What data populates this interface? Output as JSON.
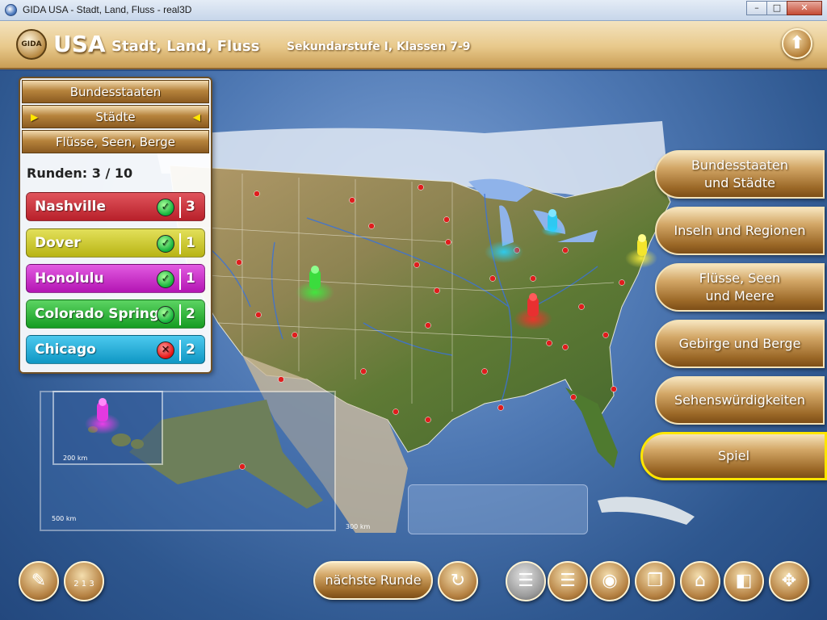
{
  "window": {
    "title": "GIDA USA - Stadt, Land, Fluss - real3D",
    "minimize": "–",
    "maximize": "□",
    "close": "✕"
  },
  "header": {
    "logo": "GIDA",
    "title": "USA",
    "subtitle": "Stadt, Land, Fluss",
    "level": "Sekundarstufe I, Klassen 7-9",
    "up_icon": "arrow-up-icon"
  },
  "panel": {
    "tabs": [
      "Bundesstaaten",
      "Städte",
      "Flüsse, Seen, Berge"
    ],
    "active_tab": "Städte",
    "rounds_label": "Runden: 3 / 10",
    "cities": [
      {
        "name": "Nashville",
        "result": "correct",
        "score": "3",
        "color": "#c9252f"
      },
      {
        "name": "Dover",
        "result": "correct",
        "score": "1",
        "color": "#c8c51a"
      },
      {
        "name": "Honolulu",
        "result": "correct",
        "score": "1",
        "color": "#c51ec4"
      },
      {
        "name": "Colorado Springs",
        "result": "correct",
        "score": "2",
        "color": "#1fae2b"
      },
      {
        "name": "Chicago",
        "result": "wrong",
        "score": "2",
        "color": "#14a9d2"
      }
    ]
  },
  "map": {
    "scale_hawaii": "200 km",
    "scale_alaska": "500 km",
    "scale_main": "300 km"
  },
  "menu": [
    {
      "label_line1": "Bundesstaaten",
      "label_line2": "und Städte",
      "active": false
    },
    {
      "label_line1": "Inseln und Regionen",
      "label_line2": "",
      "active": false
    },
    {
      "label_line1": "Flüsse, Seen",
      "label_line2": "und Meere",
      "active": false
    },
    {
      "label_line1": "Gebirge und Berge",
      "label_line2": "",
      "active": false
    },
    {
      "label_line1": "Sehenswürdigkeiten",
      "label_line2": "",
      "active": false
    },
    {
      "label_line1": "Spiel",
      "label_line2": "",
      "active": true
    }
  ],
  "toolbar": {
    "next_round": "nächste Runde",
    "icons": [
      "notes-icon",
      "ranking-podium-icon",
      "reset-icon",
      "list-icon",
      "list-active-icon",
      "camera-icon",
      "pages-icon",
      "home-icon",
      "window-mode-icon",
      "move-arrows-icon"
    ],
    "podium_numbers": "2 1 3"
  },
  "colors": {
    "gold": "#b7843d",
    "ocean": "#4f79b4",
    "active_border": "#ffe600"
  }
}
